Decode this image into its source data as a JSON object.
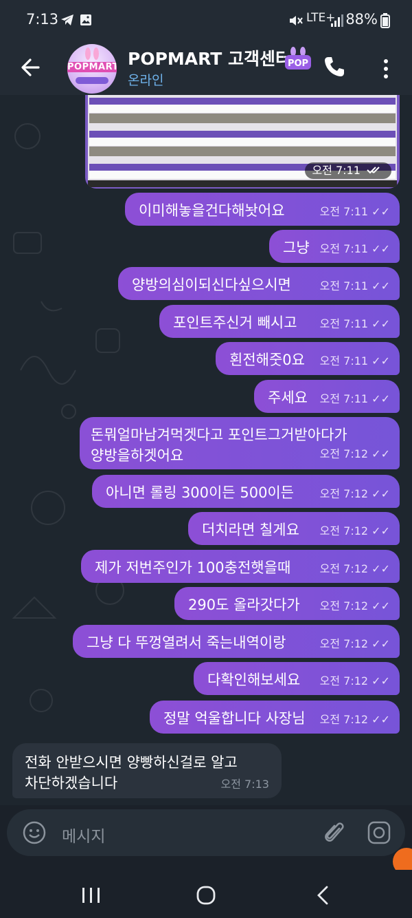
{
  "status_bar": {
    "time": "7:13",
    "network": "LTE+",
    "battery": "88%"
  },
  "header": {
    "title": "POPMART 고객센터",
    "status": "온라인",
    "avatar_text": "POPMART",
    "badge_text": "POP"
  },
  "image_message": {
    "time": "오전 7:11"
  },
  "messages": [
    {
      "text": "이미해놓을건다해놧어요",
      "time": "오전 7:11"
    },
    {
      "text": "그냥",
      "time": "오전 7:11"
    },
    {
      "text": "양방의심이되신다싶으시면",
      "time": "오전 7:11"
    },
    {
      "text": "포인트주신거 빼시고",
      "time": "오전 7:11"
    },
    {
      "text": "횐전해줏0요",
      "time": "오전 7:11"
    },
    {
      "text": "주세요",
      "time": "오전 7:11"
    },
    {
      "line1": "돈뭐얼마남겨먹겟다고 포인트그거받아다가",
      "line2": "양방을하겟어요",
      "time": "오전 7:12"
    },
    {
      "text": "아니면 롤링 300이든 500이든",
      "time": "오전 7:12"
    },
    {
      "text": "더치라면 칠게요",
      "time": "오전 7:12"
    },
    {
      "text": "제가 저번주인가 100충전햇을때",
      "time": "오전 7:12"
    },
    {
      "text": "290도 올라갓다가",
      "time": "오전 7:12"
    },
    {
      "text": "그냥 다 뚜껑열려서 죽는내역이랑",
      "time": "오전 7:12"
    },
    {
      "text": "다확인해보세요",
      "time": "오전 7:12"
    },
    {
      "text": "정말 억울합니다 사장님",
      "time": "오전 7:12"
    }
  ],
  "incoming": {
    "line1": "전화 안받으시면 양빵하신걸로 알고",
    "line2": "차단하겠습니다",
    "time": "오전 7:13"
  },
  "input": {
    "placeholder": "메시지"
  },
  "colors": {
    "bubble_out": "#8d4fd6",
    "bubble_in": "#2b333d",
    "header_bg": "#232b34",
    "online": "#6fb2ea"
  }
}
